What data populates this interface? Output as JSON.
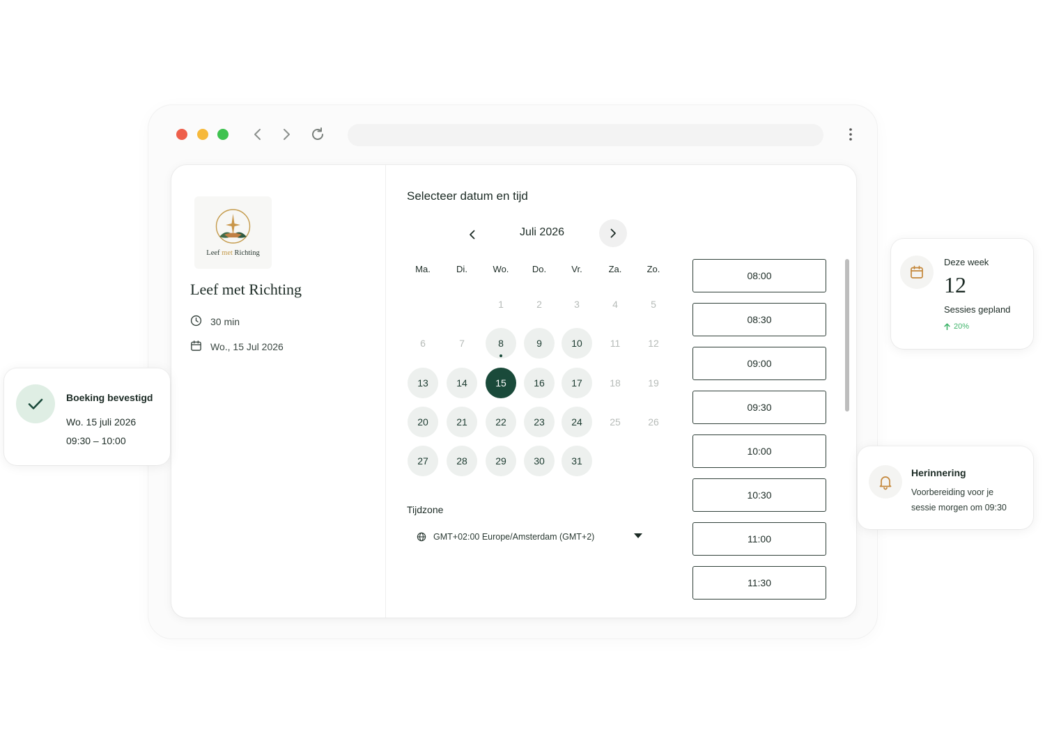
{
  "colors": {
    "accent": "#1a4a3a",
    "available_day_bg": "#edf0ee",
    "success_bg": "#dfeee4",
    "trend_up": "#3fb46a",
    "bell": "#c4873a"
  },
  "browser": {
    "controls": [
      "close-dot",
      "minimize-dot",
      "maximize-dot"
    ],
    "icons": [
      "chevron-left-icon",
      "chevron-right-icon",
      "reload-icon",
      "kebab-menu-icon"
    ]
  },
  "sidebar": {
    "logo_word1": "Leef",
    "logo_word2": "met",
    "logo_word3": "Richting",
    "org_name": "Leef met Richting",
    "duration": "30 min",
    "date": "Wo., 15 Jul 2026"
  },
  "calendar": {
    "title": "Selecteer datum en tijd",
    "month": "Juli 2026",
    "weekdays": [
      "Ma.",
      "Di.",
      "Wo.",
      "Do.",
      "Vr.",
      "Za.",
      "Zo."
    ],
    "weeks": [
      [
        null,
        null,
        {
          "d": "1",
          "s": "na"
        },
        {
          "d": "2",
          "s": "na"
        },
        {
          "d": "3",
          "s": "na"
        },
        {
          "d": "4",
          "s": "na"
        },
        {
          "d": "5",
          "s": "na"
        }
      ],
      [
        {
          "d": "6",
          "s": "na"
        },
        {
          "d": "7",
          "s": "na"
        },
        {
          "d": "8",
          "s": "av",
          "today": true
        },
        {
          "d": "9",
          "s": "av"
        },
        {
          "d": "10",
          "s": "av"
        },
        {
          "d": "11",
          "s": "na"
        },
        {
          "d": "12",
          "s": "na"
        }
      ],
      [
        {
          "d": "13",
          "s": "av"
        },
        {
          "d": "14",
          "s": "av"
        },
        {
          "d": "15",
          "s": "sel"
        },
        {
          "d": "16",
          "s": "av"
        },
        {
          "d": "17",
          "s": "av"
        },
        {
          "d": "18",
          "s": "na"
        },
        {
          "d": "19",
          "s": "na"
        }
      ],
      [
        {
          "d": "20",
          "s": "av"
        },
        {
          "d": "21",
          "s": "av"
        },
        {
          "d": "22",
          "s": "av"
        },
        {
          "d": "23",
          "s": "av"
        },
        {
          "d": "24",
          "s": "av"
        },
        {
          "d": "25",
          "s": "na"
        },
        {
          "d": "26",
          "s": "na"
        }
      ],
      [
        {
          "d": "27",
          "s": "av"
        },
        {
          "d": "28",
          "s": "av"
        },
        {
          "d": "29",
          "s": "av"
        },
        {
          "d": "30",
          "s": "av"
        },
        {
          "d": "31",
          "s": "av"
        },
        null,
        null
      ]
    ]
  },
  "timezone": {
    "label": "Tijdzone",
    "value": "GMT+02:00 Europe/Amsterdam (GMT+2)"
  },
  "time_slots": [
    "08:00",
    "08:30",
    "09:00",
    "09:30",
    "10:00",
    "10:30",
    "11:00",
    "11:30"
  ],
  "booking_toast": {
    "title": "Boeking bevestigd",
    "date": "Wo. 15 juli 2026",
    "time": "09:30 – 10:00"
  },
  "stats": {
    "label": "Deze week",
    "value": "12",
    "sub": "Sessies gepland",
    "trend": "20%"
  },
  "reminder": {
    "title": "Herinnering",
    "line1": "Voorbereiding voor je",
    "line2": "sessie morgen om 09:30"
  }
}
